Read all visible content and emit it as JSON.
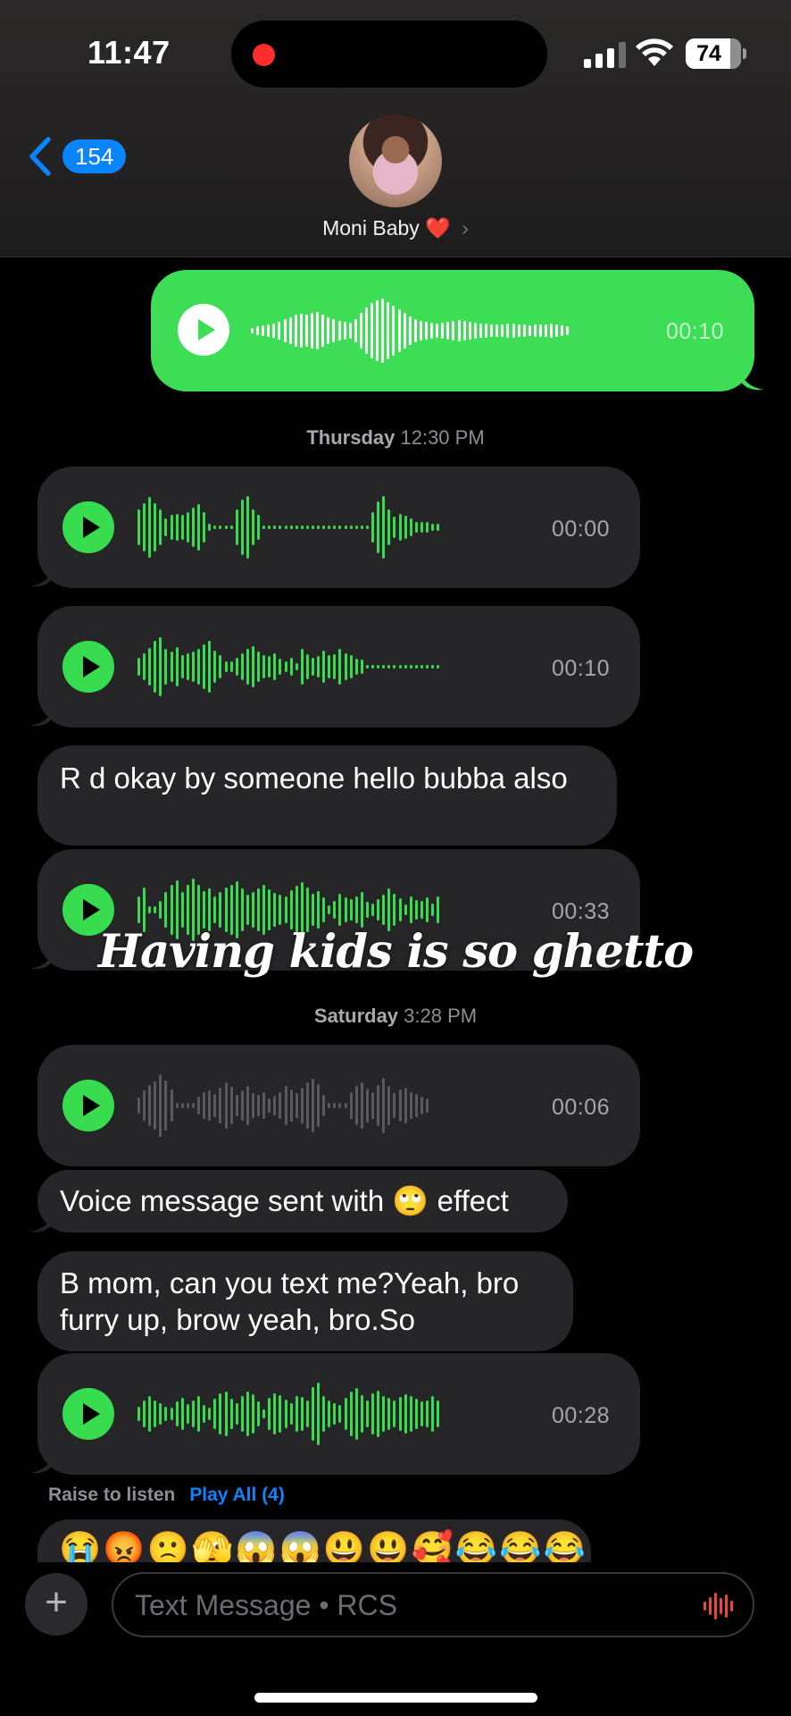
{
  "status": {
    "time": "11:47",
    "battery": "74"
  },
  "nav": {
    "back_count": "154",
    "contact_name": "Moni Baby",
    "heart": "❤️",
    "chevron": "›"
  },
  "messages": {
    "out_voice": {
      "duration": "00:10"
    },
    "ts1": {
      "day": "Thursday",
      "time": "12:30 PM"
    },
    "voice1": {
      "duration": "00:00"
    },
    "voice2": {
      "duration": "00:10"
    },
    "text1": "R d okay by someone hello bubba also",
    "voice3": {
      "duration": "00:33"
    },
    "ts2": {
      "day": "Saturday",
      "time": "3:28 PM"
    },
    "voice4": {
      "duration": "00:06"
    },
    "text2": {
      "before": "Voice message sent with",
      "emoji": "🙄",
      "after": "effect"
    },
    "text3": "B mom, can you text me?Yeah, bro furry up, brow yeah, bro.So",
    "voice5": {
      "duration": "00:28"
    }
  },
  "overlay_caption": "Having kids is so ghetto",
  "raise": {
    "label": "Raise to listen",
    "play_all": "Play All (4)"
  },
  "emoji_row": "😭😡🙁🫣😱😱😃😃🥰😂😂😂",
  "composer": {
    "plus": "+",
    "placeholder": "Text Message • RCS"
  },
  "colors": {
    "sent": "#3ddd55",
    "received": "#262628",
    "accent": "#0a84ff",
    "wave_active": "#37dc4f",
    "wave_played": "#5a5a5e"
  }
}
